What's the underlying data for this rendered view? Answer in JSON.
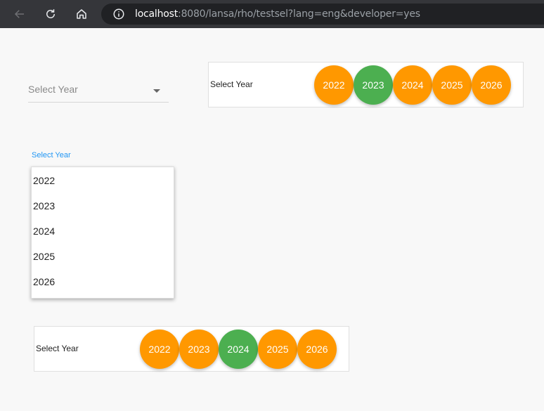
{
  "browser": {
    "url_host": "localhost",
    "url_rest": ":8080/lansa/rho/testsel?lang=eng&developer=yes"
  },
  "select_collapsed": {
    "placeholder": "Select Year"
  },
  "year_selector_top": {
    "label": "Select Year",
    "years": [
      "2022",
      "2023",
      "2024",
      "2025",
      "2026"
    ],
    "selected": "2023"
  },
  "select_open": {
    "label": "Select Year",
    "options": [
      "2022",
      "2023",
      "2024",
      "2025",
      "2026"
    ]
  },
  "year_selector_bottom": {
    "label": "Select Year",
    "years": [
      "2022",
      "2023",
      "2024",
      "2025",
      "2026"
    ],
    "selected": "2024"
  },
  "colors": {
    "circle_default": "#ff9800",
    "circle_selected": "#4caf50",
    "accent_label": "#2196f3"
  }
}
